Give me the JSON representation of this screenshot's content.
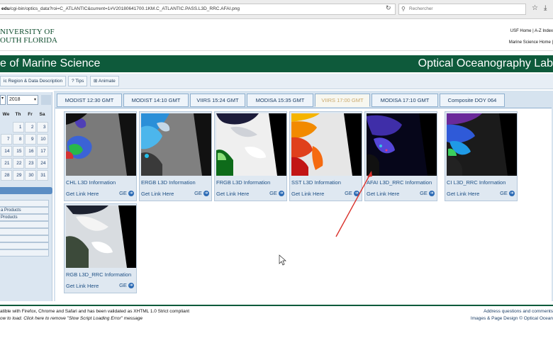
{
  "browser": {
    "url_host": "edu",
    "url_path": "/cgi-bin/optics_data?roi=C_ATLANTIC&current=1#V20180641700.1KM.C_ATLANTIC.PASS.L3D_RRC.AFAI.png",
    "search_placeholder": "Rechercher"
  },
  "header": {
    "logo_line1": "NIVERSITY OF",
    "logo_line2": "OUTH FLORIDA",
    "top_links": "USF Home | A-Z Index",
    "sub_links": "Marine Science Home |"
  },
  "banner": {
    "left_text": "e of Marine Science",
    "right_text": "Optical Oceanography Lab"
  },
  "toolbar": {
    "region_label": "ic Region & Data Description",
    "tips_label": "? Tips",
    "animate_label": "⊞ Animate"
  },
  "calendar": {
    "year": "2018",
    "headers": [
      "We",
      "Th",
      "Fr",
      "Sa"
    ],
    "rows": [
      [
        "",
        "1",
        "2",
        "3"
      ],
      [
        "7",
        "8",
        "9",
        "10"
      ],
      [
        "14",
        "15",
        "16",
        "17"
      ],
      [
        "21",
        "22",
        "23",
        "24"
      ],
      [
        "28",
        "29",
        "30",
        "31"
      ]
    ]
  },
  "sidebar": {
    "items": [
      "",
      "a Products",
      "Products",
      "",
      "",
      "",
      "",
      ""
    ]
  },
  "tabs": [
    {
      "label": "MODIST 12:30 GMT",
      "active": false
    },
    {
      "label": "MODIST 14:10 GMT",
      "active": false
    },
    {
      "label": "VIIRS 15:24 GMT",
      "active": false
    },
    {
      "label": "MODISA 15:35 GMT",
      "active": false
    },
    {
      "label": "VIIRS 17:00 GMT",
      "active": true
    },
    {
      "label": "MODISA 17:10 GMT",
      "active": false
    },
    {
      "label": "Composite DOY 064",
      "active": false
    }
  ],
  "cards": [
    {
      "title": "CHL L3D Information",
      "link": "Get Link Here",
      "ge": "GE"
    },
    {
      "title": "ERGB L3D Information",
      "link": "Get Link Here",
      "ge": "GE"
    },
    {
      "title": "FRGB L3D Information",
      "link": "Get Link Here",
      "ge": "GE"
    },
    {
      "title": "SST L3D Information",
      "link": "Get Link Here",
      "ge": "GE"
    },
    {
      "title": "AFAI L3D_RRC Information",
      "link": "Get Link Here",
      "ge": "GE"
    },
    {
      "title": "CI L3D_RRC Information",
      "link": "Get Link Here",
      "ge": "GE"
    },
    {
      "title": "RGB L3D_RRC Information",
      "link": "Get Link Here",
      "ge": "GE"
    }
  ],
  "footer": {
    "left1": "atible with Firefox, Chrome and Safari and has been validated as XHTML 1.0 Strict compliant",
    "left2": "ow to load. Click here to remove \"Slow Script Loading Error\" message",
    "right1": "Address questions and comments",
    "right2": "Images & Page Design  © Optical Ocean"
  },
  "colors": {
    "banner_green": "#0e5a3b",
    "active_tab_text": "#c9a86b",
    "link_blue": "#1d4f84",
    "annotation_red": "#d9312b"
  }
}
